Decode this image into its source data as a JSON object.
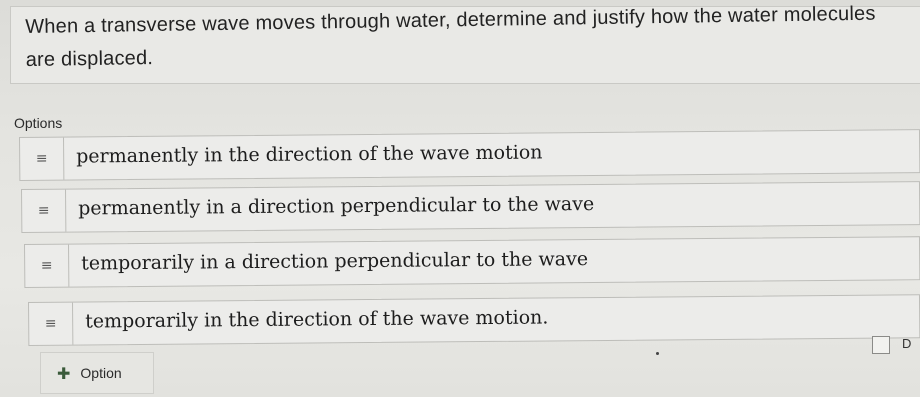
{
  "question": {
    "text": "When a transverse wave moves through water, determine and justify how the water molecules are displaced."
  },
  "options_section": {
    "label": "Options",
    "handle_icon": "drag-handle-icon",
    "items": [
      {
        "text": "permanently in the direction of the wave motion"
      },
      {
        "text": "permanently in a direction perpendicular to the wave"
      },
      {
        "text": "temporarily in a direction perpendicular to the wave"
      },
      {
        "text": "temporarily in the direction of the wave motion."
      }
    ]
  },
  "add_option": {
    "label": "Option",
    "icon": "plus-icon"
  },
  "right_edge": {
    "label": "D"
  }
}
